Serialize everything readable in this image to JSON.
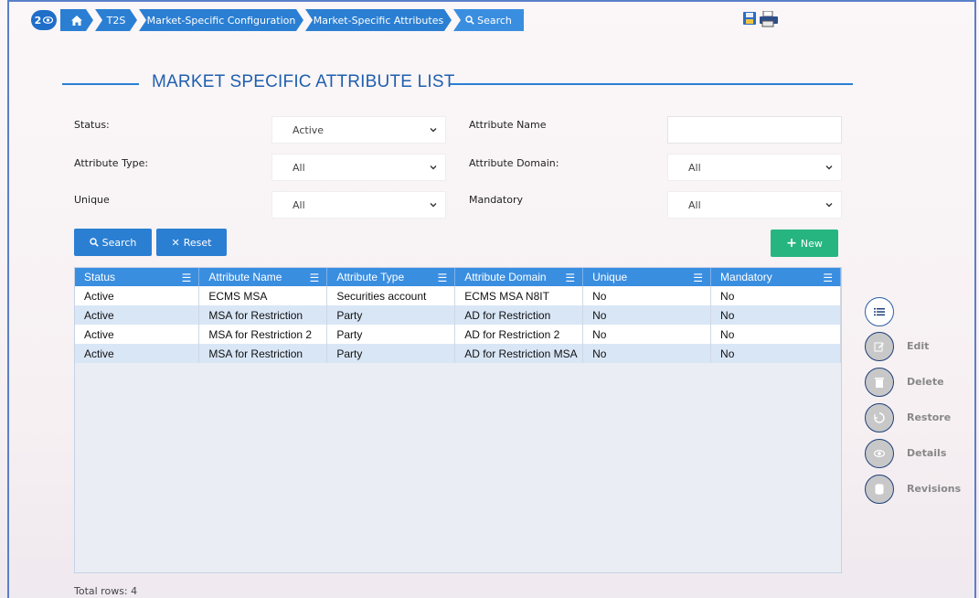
{
  "breadcrumb": {
    "counter": "2",
    "items": [
      "T2S",
      "Market-Specific Configuration",
      "Market-Specific Attributes",
      "Search"
    ]
  },
  "page_title": "MARKET SPECIFIC ATTRIBUTE LIST",
  "filters": {
    "status_label": "Status:",
    "status_value": "Active",
    "attribute_name_label": "Attribute Name",
    "attribute_name_value": "",
    "attribute_type_label": "Attribute Type:",
    "attribute_type_value": "All",
    "attribute_domain_label": "Attribute Domain:",
    "attribute_domain_value": "All",
    "unique_label": "Unique",
    "unique_value": "All",
    "mandatory_label": "Mandatory",
    "mandatory_value": "All"
  },
  "buttons": {
    "search": "Search",
    "reset": "Reset",
    "new": "New"
  },
  "table": {
    "columns": [
      "Status",
      "Attribute Name",
      "Attribute Type",
      "Attribute Domain",
      "Unique",
      "Mandatory"
    ],
    "rows": [
      [
        "Active",
        "ECMS MSA",
        "Securities account",
        "ECMS MSA N8IT",
        "No",
        "No"
      ],
      [
        "Active",
        "MSA for Restriction",
        "Party",
        "AD for Restriction",
        "No",
        "No"
      ],
      [
        "Active",
        "MSA for Restriction 2",
        "Party",
        "AD for Restriction 2",
        "No",
        "No"
      ],
      [
        "Active",
        "MSA for Restriction",
        "Party",
        "AD for Restriction MSA",
        "No",
        "No"
      ]
    ]
  },
  "side_actions": [
    "Edit",
    "Delete",
    "Restore",
    "Details",
    "Revisions"
  ],
  "total_rows": "Total rows: 4",
  "colors": {
    "primary": "#2b7fd3",
    "header": "#3a8ee0",
    "new_button": "#26b581",
    "alt_row": "#d9e6f6"
  }
}
